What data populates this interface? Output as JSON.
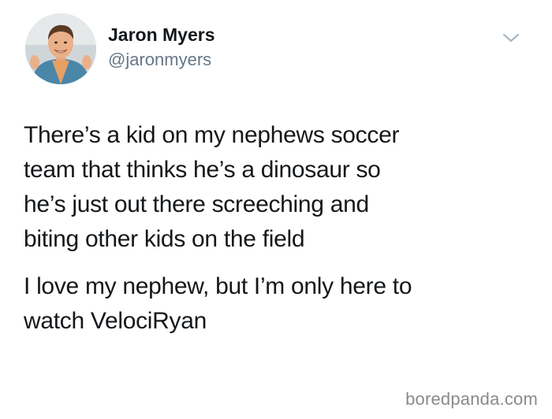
{
  "author": {
    "display_name": "Jaron Myers",
    "handle": "@jaronmyers",
    "avatar_icon": "profile-photo"
  },
  "menu": {
    "icon": "chevron-down-icon",
    "color": "#aab8c2"
  },
  "tweet": {
    "paragraphs": [
      "There’s a kid on my nephews soccer\nteam that thinks he’s a dinosaur so\nhe’s just out there screeching and\nbiting other kids on the field",
      "I love my nephew, but I’m only here to\nwatch VelociRyan"
    ]
  },
  "watermark": {
    "text": "boredpanda.com"
  },
  "colors": {
    "text": "#14171a",
    "secondary_text": "#657786",
    "background": "#ffffff"
  }
}
